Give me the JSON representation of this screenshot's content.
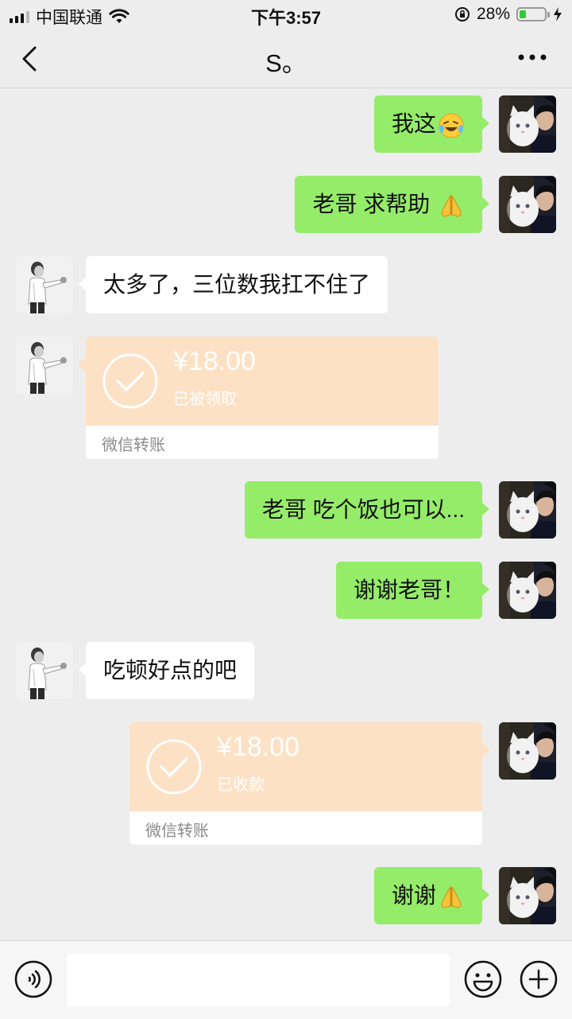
{
  "status_bar": {
    "carrier": "中国联通",
    "time": "下午3:57",
    "battery_percent": "28%",
    "battery_level": 0.28
  },
  "nav": {
    "title": "S。"
  },
  "messages": [
    {
      "text": "我这",
      "emoji": "laughing-crying-emoji"
    },
    {
      "text": "老哥 求帮助",
      "emoji": "pray-emoji"
    },
    {
      "text": "太多了，三位数我扛不住了"
    },
    {
      "amount": "¥18.00",
      "status": "已被领取",
      "brand": "微信转账"
    },
    {
      "text": "老哥 吃个饭也可以..."
    },
    {
      "text": "谢谢老哥！"
    },
    {
      "text": "吃顿好点的吧"
    },
    {
      "amount": "¥18.00",
      "status": "已收款",
      "brand": "微信转账"
    },
    {
      "text": "谢谢",
      "emoji": "pray-emoji"
    }
  ],
  "colors": {
    "outgoing_bubble": "#95ec69",
    "incoming_bubble": "#ffffff",
    "transfer_card": "#fde1c5",
    "background": "#ededed"
  }
}
